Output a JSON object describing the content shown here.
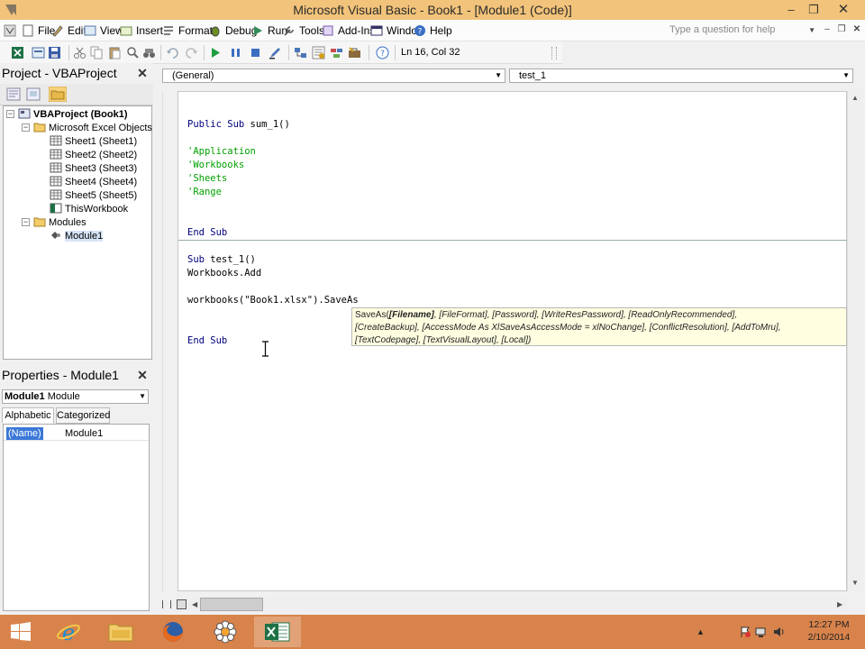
{
  "window": {
    "title": "Microsoft Visual Basic - Book1 - [Module1 (Code)]"
  },
  "menu": {
    "items": [
      "File",
      "Edit",
      "View",
      "Insert",
      "Format",
      "Debug",
      "Run",
      "Tools",
      "Add-Ins",
      "Window",
      "Help"
    ],
    "help_placeholder": "Type a question for help"
  },
  "toolbar": {
    "position": "Ln 16, Col 32"
  },
  "project": {
    "title": "Project - VBAProject",
    "root": "VBAProject (Book1)",
    "folder_objects": "Microsoft Excel Objects",
    "sheets": [
      "Sheet1 (Sheet1)",
      "Sheet2 (Sheet2)",
      "Sheet3 (Sheet3)",
      "Sheet4 (Sheet4)",
      "Sheet5 (Sheet5)"
    ],
    "workbook": "ThisWorkbook",
    "folder_modules": "Modules",
    "module": "Module1"
  },
  "properties": {
    "title": "Properties - Module1",
    "object_name": "Module1",
    "object_type": "Module",
    "tab_alpha": "Alphabetic",
    "tab_cat": "Categorized",
    "prop_name": "(Name)",
    "prop_value": "Module1"
  },
  "code": {
    "object_combo": "(General)",
    "proc_combo": "test_1",
    "lines": {
      "l1a": "Public Sub",
      "l1b": " sum_1()",
      "c1": "'Application",
      "c2": "'Workbooks",
      "c3": "'Sheets",
      "c4": "'Range",
      "end1": "End Sub",
      "l2a": "Sub",
      "l2b": " test_1()",
      "l3": "Workbooks.Add",
      "l4": "workbooks(\"Book1.xlsx\").SaveAs",
      "end2": "End Sub"
    }
  },
  "tooltip": {
    "fn": "SaveAs(",
    "p1": "[Filename]",
    "rest1": ", [FileFormat], [Password], [WriteResPassword], [ReadOnlyRecommended],",
    "line2": "[CreateBackup], [AccessMode As XlSaveAsAccessMode = xlNoChange], [ConflictResolution], [AddToMru],",
    "line3": "[TextCodepage], [TextVisualLayout], [Local])"
  },
  "clock": {
    "time": "12:27 PM",
    "date": "2/10/2014"
  }
}
